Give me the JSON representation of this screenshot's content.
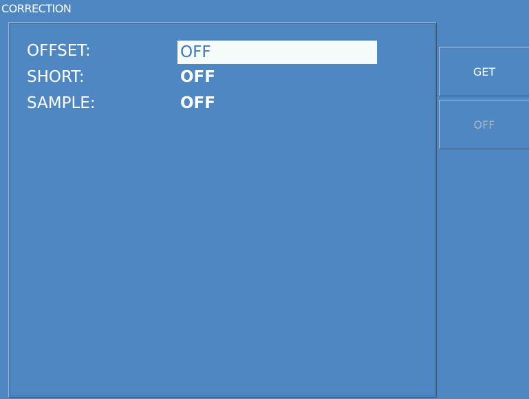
{
  "header": {
    "title": "CORRECTION"
  },
  "parameters": [
    {
      "label": "OFFSET:",
      "value": "OFF"
    },
    {
      "label": "SHORT:",
      "value": "OFF"
    },
    {
      "label": "SAMPLE:",
      "value": "OFF"
    }
  ],
  "softkeys": [
    {
      "label": "GET"
    },
    {
      "label": "OFF"
    }
  ],
  "colors": {
    "background": "#4f87c2",
    "highlight": "#f4fbf9",
    "highlight_text": "#3d79bf",
    "text": "#ffffff",
    "disabled_text": "#a6b8c8"
  }
}
